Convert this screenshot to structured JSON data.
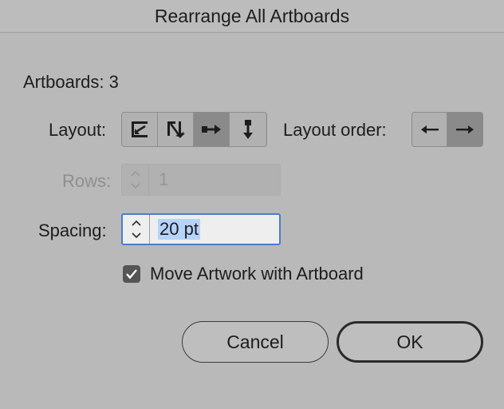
{
  "dialog": {
    "title": "Rearrange All Artboards"
  },
  "artboards": {
    "label": "Artboards: 3"
  },
  "layout": {
    "label": "Layout:",
    "options": [
      {
        "icon": "grid-by-row-icon",
        "active": false
      },
      {
        "icon": "grid-by-column-icon",
        "active": false
      },
      {
        "icon": "arrange-by-row-icon",
        "active": true
      },
      {
        "icon": "arrange-by-column-icon",
        "active": false
      }
    ]
  },
  "layout_order": {
    "label": "Layout order:",
    "options": [
      {
        "icon": "arrow-left-icon",
        "active": false
      },
      {
        "icon": "arrow-right-icon",
        "active": true
      }
    ]
  },
  "rows": {
    "label": "Rows:",
    "value": "1",
    "disabled": true
  },
  "spacing": {
    "label": "Spacing:",
    "value": "20 pt"
  },
  "move_artwork": {
    "label": "Move Artwork with Artboard",
    "checked": true
  },
  "buttons": {
    "cancel": "Cancel",
    "ok": "OK"
  },
  "colors": {
    "background": "#b9b9b9",
    "focus_ring": "#4b7ccb",
    "selection": "#b6d3f9",
    "active_segment": "#8a8a8a"
  }
}
